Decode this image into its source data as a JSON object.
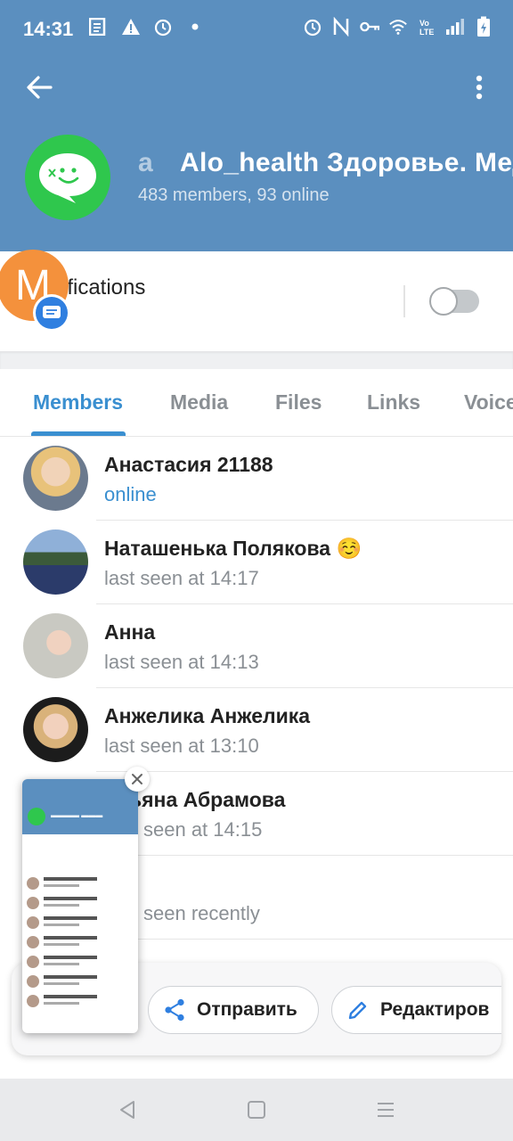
{
  "status_bar": {
    "time": "14:31",
    "left_icons": [
      "document-icon",
      "warning-icon",
      "alarm-icon",
      "dot-icon"
    ],
    "right_icons": [
      "alarm-icon",
      "nfc-icon",
      "key-icon",
      "wifi-icon",
      "volte-icon",
      "signal-icon",
      "battery-icon"
    ]
  },
  "header": {
    "title_fragment": "a",
    "title": "Alo_health Здоровье. Медицина",
    "subtitle": "483 members, 93 online",
    "avatar_color": "#2fc74d",
    "bar_color": "#5b8fbf"
  },
  "notifications": {
    "label": "ifications",
    "enabled": false
  },
  "floating_avatar": {
    "letter": "M",
    "color": "#f4913c"
  },
  "tabs": [
    {
      "label": "Members",
      "active": true
    },
    {
      "label": "Media",
      "active": false
    },
    {
      "label": "Files",
      "active": false
    },
    {
      "label": "Links",
      "active": false
    },
    {
      "label": "Voice",
      "active": false
    }
  ],
  "members": [
    {
      "name": "Анастасия 21188",
      "status": "online",
      "online": true
    },
    {
      "name": "Наташенька Полякова ☺️",
      "status": "last seen at 14:17",
      "online": false
    },
    {
      "name": "Анна",
      "status": "last seen at 14:13",
      "online": false
    },
    {
      "name": "Анжелика Анжелика",
      "status": "last seen at 13:10",
      "online": false
    },
    {
      "name": "ьяна Абрамова",
      "status": "seen at 14:15",
      "online": false
    },
    {
      "name": "",
      "status": "seen recently",
      "online": false
    }
  ],
  "share_actions": {
    "send": "Отправить",
    "edit": "Редактиров"
  },
  "accent_color": "#3a8fd0"
}
